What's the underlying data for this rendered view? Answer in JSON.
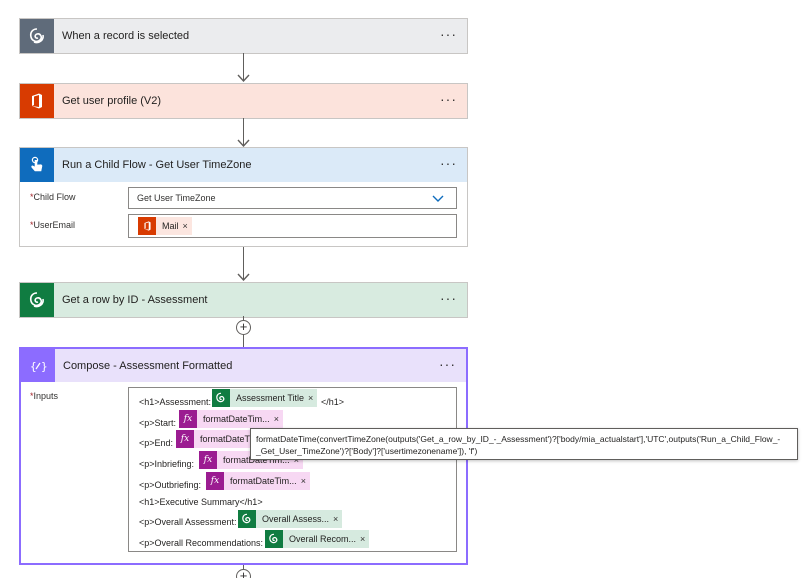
{
  "steps": [
    {
      "title": "When a record is selected"
    },
    {
      "title": "Get user profile (V2)"
    },
    {
      "title": "Run a Child Flow - Get User TimeZone"
    },
    {
      "title": "Get a row by ID - Assessment"
    },
    {
      "title": "Compose - Assessment Formatted"
    }
  ],
  "more_label": "···",
  "child_flow": {
    "child_flow_label": "Child Flow",
    "child_flow_value": "Get User TimeZone",
    "user_email_label": "UserEmail",
    "user_email_token": "Mail"
  },
  "compose": {
    "inputs_label": "Inputs",
    "lines": [
      {
        "prefix": "<h1>Assessment:",
        "token": "Assessment Title",
        "suffix": "</h1>"
      },
      {
        "prefix": "<p>Start:",
        "token": "formatDateTim..."
      },
      {
        "prefix": "<p>End:",
        "token": "formatDateTi"
      },
      {
        "prefix": "<p>Inbriefing:",
        "token": "formatDateTim..."
      },
      {
        "prefix": "<p>Outbriefing:",
        "token": "formatDateTim..."
      },
      {
        "prefix": "<h1>Executive Summary</h1>"
      },
      {
        "prefix": "<p>Overall Assessment:",
        "token": "Overall Assess..."
      },
      {
        "prefix": "<p>Overall Recommendations:",
        "token": "Overall Recom..."
      }
    ]
  },
  "tooltip_text": "formatDateTime(convertTimeZone(outputs('Get_a_row_by_ID_-_Assessment')?['body/mia_actualstart'],'UTC',outputs('Run_a_Child_Flow_-_Get_User_TimeZone')?['Body']?['usertimezonename']), 'f')",
  "token_remove": "×",
  "required_mark": "*",
  "plus_symbol": "+",
  "colors": {
    "dataverse": "#107c41",
    "office": "#d83b01",
    "child_flow": "#0f6cbd",
    "compose": "#8c6cff",
    "trigger": "#5f6b7a"
  }
}
